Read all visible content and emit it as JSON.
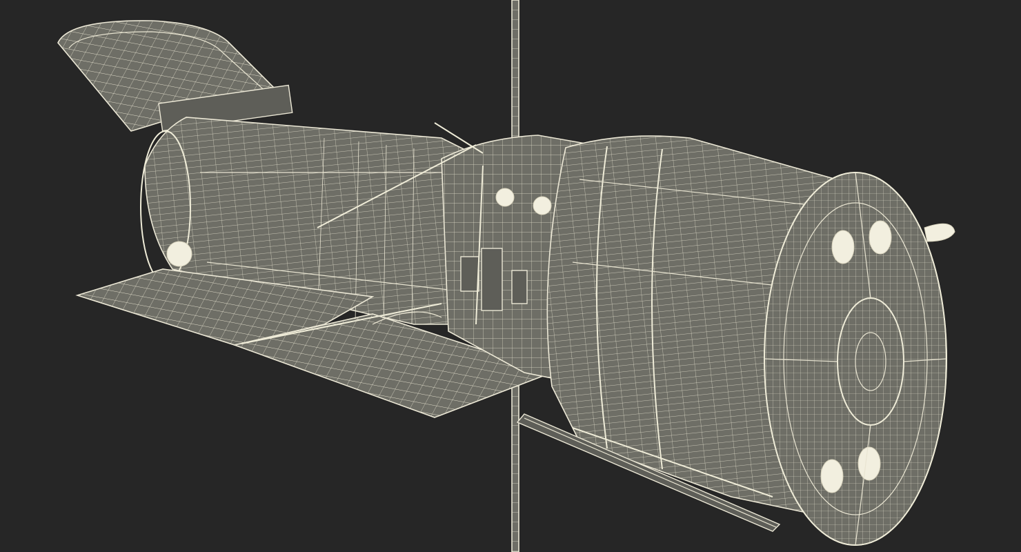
{
  "scene": {
    "background_color": "#262626",
    "wire_color": "#e9e5d2",
    "surface_color": "#6e6e66",
    "subject": "wireframe-satellite-model"
  }
}
